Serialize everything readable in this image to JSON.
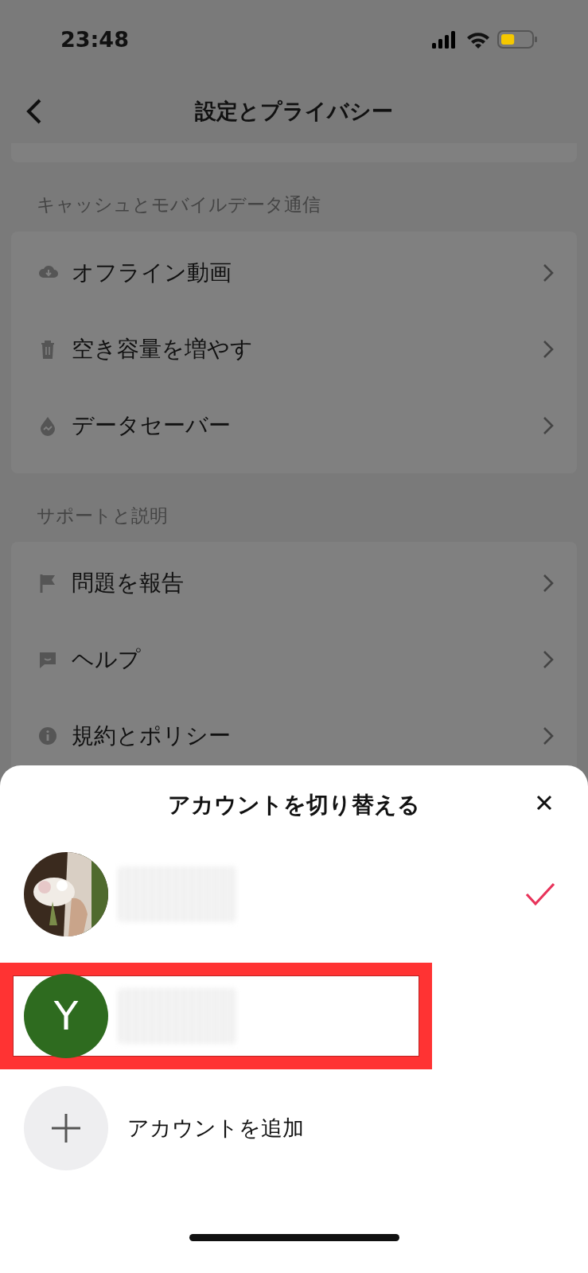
{
  "status_bar": {
    "time": "23:48"
  },
  "header": {
    "title": "設定とプライバシー"
  },
  "sections": [
    {
      "title": "キャッシュとモバイルデータ通信",
      "items": [
        {
          "label": "オフライン動画",
          "kind": "cloud"
        },
        {
          "label": "空き容量を増やす",
          "kind": "trash"
        },
        {
          "label": "データセーバー",
          "kind": "drop"
        }
      ]
    },
    {
      "title": "サポートと説明",
      "items": [
        {
          "label": "問題を報告",
          "kind": "flag"
        },
        {
          "label": "ヘルプ",
          "kind": "chat"
        },
        {
          "label": "規約とポリシー",
          "kind": "info"
        }
      ]
    }
  ],
  "sheet": {
    "title": "アカウントを切り替える",
    "accounts": [
      {
        "selected": true,
        "highlighted": false
      },
      {
        "avatar": {
          "kind": "letter",
          "letter": "Y",
          "color": "#2e6b1f"
        },
        "selected": false,
        "highlighted": true
      }
    ],
    "add_account": {
      "label": "アカウントを追加"
    }
  }
}
